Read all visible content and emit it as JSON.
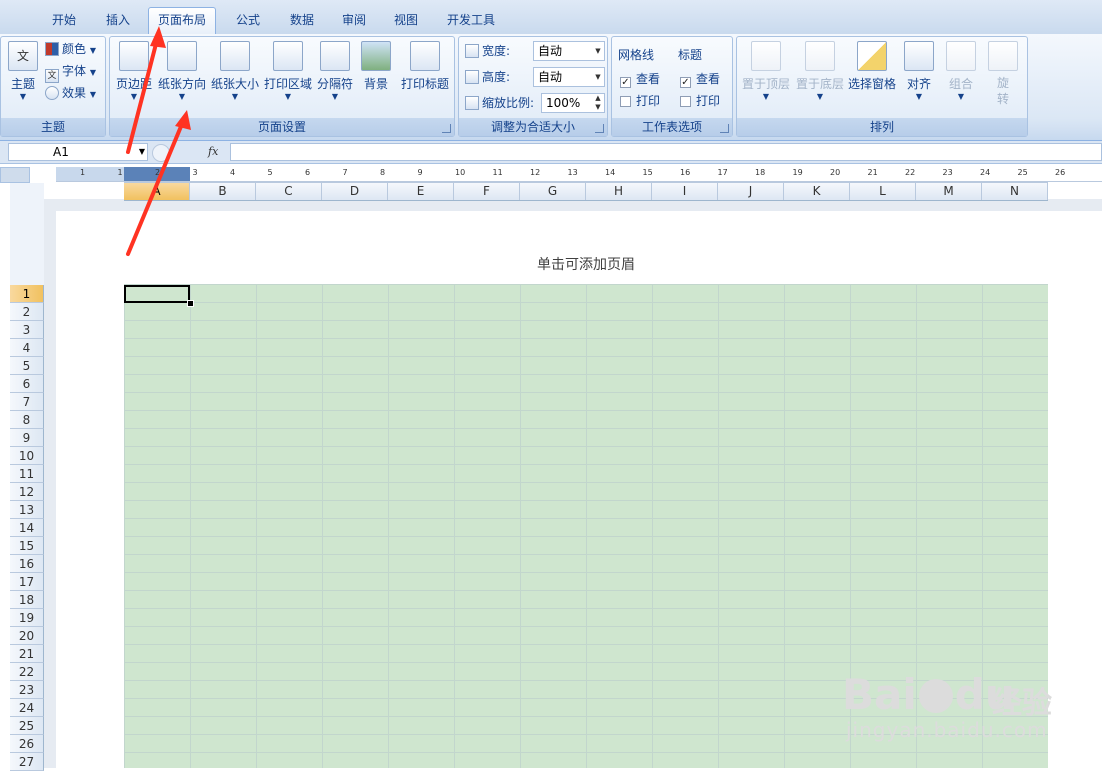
{
  "tabs": [
    "开始",
    "插入",
    "页面布局",
    "公式",
    "数据",
    "审阅",
    "视图",
    "开发工具"
  ],
  "active_tab": "页面布局",
  "ribbon": {
    "theme_group": {
      "label": "主题",
      "theme_btn": "主题",
      "colors": "颜色",
      "fonts": "字体",
      "effects": "效果"
    },
    "page_setup_group": {
      "label": "页面设置",
      "margins": "页边距",
      "orientation": "纸张方向",
      "size": "纸张大小",
      "print_area": "打印区域",
      "breaks": "分隔符",
      "background": "背景",
      "print_titles": "打印标题"
    },
    "scale_group": {
      "label": "调整为合适大小",
      "width_label": "宽度:",
      "width_value": "自动",
      "height_label": "高度:",
      "height_value": "自动",
      "scale_label": "缩放比例:",
      "scale_value": "100%"
    },
    "sheet_options_group": {
      "label": "工作表选项",
      "gridlines": "网格线",
      "headings": "标题",
      "view": "查看",
      "print": "打印",
      "gridlines_view_checked": true,
      "gridlines_print_checked": false,
      "headings_view_checked": true,
      "headings_print_checked": false
    },
    "arrange_group": {
      "label": "排列",
      "bring_front": "置于顶层",
      "send_back": "置于底层",
      "selection_pane": "选择窗格",
      "align": "对齐",
      "group": "组合",
      "rotate": "旋转"
    }
  },
  "formula_bar": {
    "name_box": "A1",
    "fx": "fx",
    "value": ""
  },
  "columns": [
    "A",
    "B",
    "C",
    "D",
    "E",
    "F",
    "G",
    "H",
    "I",
    "J",
    "K",
    "L",
    "M",
    "N"
  ],
  "rows": [
    "1",
    "2",
    "3",
    "4",
    "5",
    "6",
    "7",
    "8",
    "9",
    "10",
    "11",
    "12",
    "13",
    "14",
    "15",
    "16",
    "17",
    "18",
    "19",
    "20",
    "21",
    "22",
    "23",
    "24",
    "25",
    "26",
    "27"
  ],
  "ruler_numbers": [
    "1",
    "1",
    "2",
    "3",
    "4",
    "5",
    "6",
    "7",
    "8",
    "9",
    "10",
    "11",
    "12",
    "13",
    "14",
    "15",
    "16",
    "17",
    "18",
    "19",
    "20",
    "21",
    "22",
    "23",
    "24",
    "25",
    "26"
  ],
  "header_placeholder": "单击可添加页眉",
  "selected_cell": "A1",
  "watermark": {
    "brand": "Bai",
    "brand2": "du",
    "cn": "经验",
    "url": "jingyan.baidu.com"
  },
  "colors": {
    "ribbon_text": "#15428b",
    "selection_header": "#f1c15f",
    "grid_fill": "#cfe6cf",
    "arrow": "#ff3322"
  }
}
